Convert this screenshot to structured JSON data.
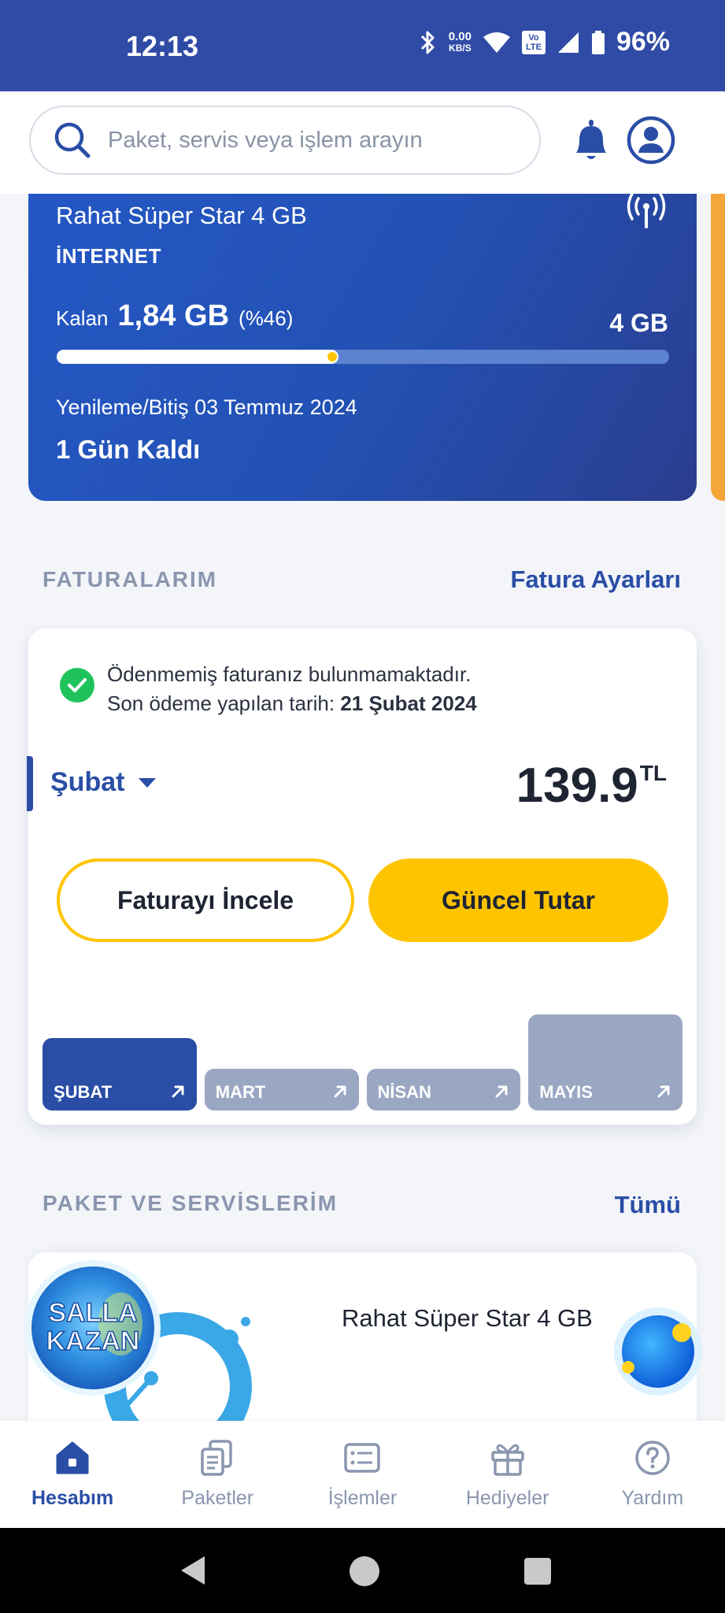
{
  "status_bar": {
    "time": "12:13",
    "net_speed_value": "0.00",
    "net_speed_unit": "KB/S",
    "volte_top": "Vo",
    "volte_bottom": "LTE",
    "battery": "96%"
  },
  "search": {
    "placeholder": "Paket, servis veya işlem arayın"
  },
  "internet_card": {
    "package_name": "Rahat Süper Star 4 GB",
    "type": "İNTERNET",
    "remaining_label": "Kalan",
    "remaining_amount": "1,84 GB",
    "remaining_percent": "(%46)",
    "remaining_fraction": 0.46,
    "total": "4 GB",
    "renewal_text": "Yenileme/Bitiş 03 Temmuz 2024",
    "days_left": "1 Gün Kaldı"
  },
  "invoices": {
    "section_title": "FATURALARIM",
    "settings_link": "Fatura Ayarları",
    "status_message": "Ödenmemiş faturanız bulunmamaktadır.",
    "last_payment_label": "Son ödeme yapılan tarih:",
    "last_payment_date": "21 Şubat 2024",
    "selected_month": "Şubat",
    "amount": "139.9",
    "currency": "TL",
    "review_button": "Faturayı İncele",
    "current_amount_button": "Güncel Tutar",
    "months": [
      {
        "label": "ŞUBAT",
        "level": 0.57,
        "active": true
      },
      {
        "label": "MART",
        "level": 0.33,
        "active": false
      },
      {
        "label": "NİSAN",
        "level": 0.33,
        "active": false
      },
      {
        "label": "MAYIS",
        "level": 0.75,
        "active": false
      }
    ]
  },
  "packages": {
    "section_title": "PAKET VE SERVİSLERİM",
    "all_link": "Tümü",
    "package_name": "Rahat Süper Star 4 GB",
    "promo_line1": "SALLA",
    "promo_line2": "KAZAN"
  },
  "bottom_nav": {
    "items": [
      {
        "label": "Hesabım",
        "icon": "home-icon",
        "active": true
      },
      {
        "label": "Paketler",
        "icon": "packages-icon",
        "active": false
      },
      {
        "label": "İşlemler",
        "icon": "operations-icon",
        "active": false
      },
      {
        "label": "Hediyeler",
        "icon": "gift-icon",
        "active": false
      },
      {
        "label": "Yardım",
        "icon": "help-icon",
        "active": false
      }
    ]
  },
  "colors": {
    "brand_blue": "#2a4ea6",
    "status_bar": "#2f4ba5",
    "accent_yellow": "#ffc400",
    "inactive_month": "#9aa7c3"
  }
}
